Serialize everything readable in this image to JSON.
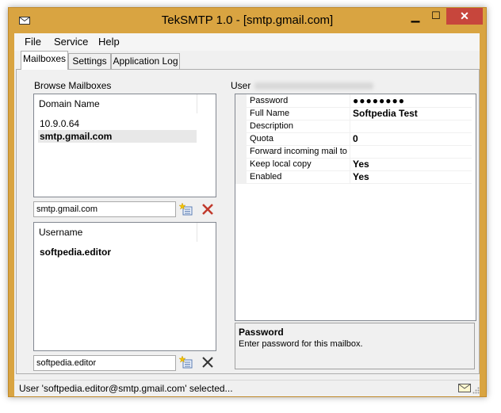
{
  "window": {
    "title": "TekSMTP 1.0 - [smtp.gmail.com]",
    "minimize_glyph": "▁",
    "maximize_glyph": "☐",
    "close_glyph": "✕"
  },
  "menu": [
    "File",
    "Service",
    "Help"
  ],
  "tabs": [
    {
      "label": "Mailboxes",
      "active": true
    },
    {
      "label": "Settings",
      "active": false
    },
    {
      "label": "Application Log",
      "active": false
    }
  ],
  "browse": {
    "group_label": "Browse Mailboxes",
    "domain_header": "Domain Name",
    "domains": [
      "10.9.0.64",
      "smtp.gmail.com"
    ],
    "selected_domain_index": 1,
    "domain_input_value": "smtp.gmail.com",
    "username_header": "Username",
    "usernames": [
      "softpedia.editor"
    ],
    "user_input_value": "softpedia.editor"
  },
  "user_group": {
    "label": "User"
  },
  "properties": [
    {
      "name": "Password",
      "value": "●●●●●●●●"
    },
    {
      "name": "Full Name",
      "value": "Softpedia Test"
    },
    {
      "name": "Description",
      "value": ""
    },
    {
      "name": "Quota",
      "value": "0"
    },
    {
      "name": "Forward incoming mail to",
      "value": ""
    },
    {
      "name": "Keep local copy",
      "value": "Yes"
    },
    {
      "name": "Enabled",
      "value": "Yes"
    }
  ],
  "property_description": {
    "title": "Password",
    "text": "Enter password for this mailbox."
  },
  "status": {
    "text": "User 'softpedia.editor@smtp.gmail.com' selected..."
  },
  "colors": {
    "title_bar": "#d9a441",
    "close_button": "#c7463c",
    "delete_icon": "#c0392b"
  },
  "icons": {
    "app": "envelope-icon",
    "add": "add-item-icon",
    "delete": "delete-x-icon",
    "status": "envelope-icon"
  }
}
